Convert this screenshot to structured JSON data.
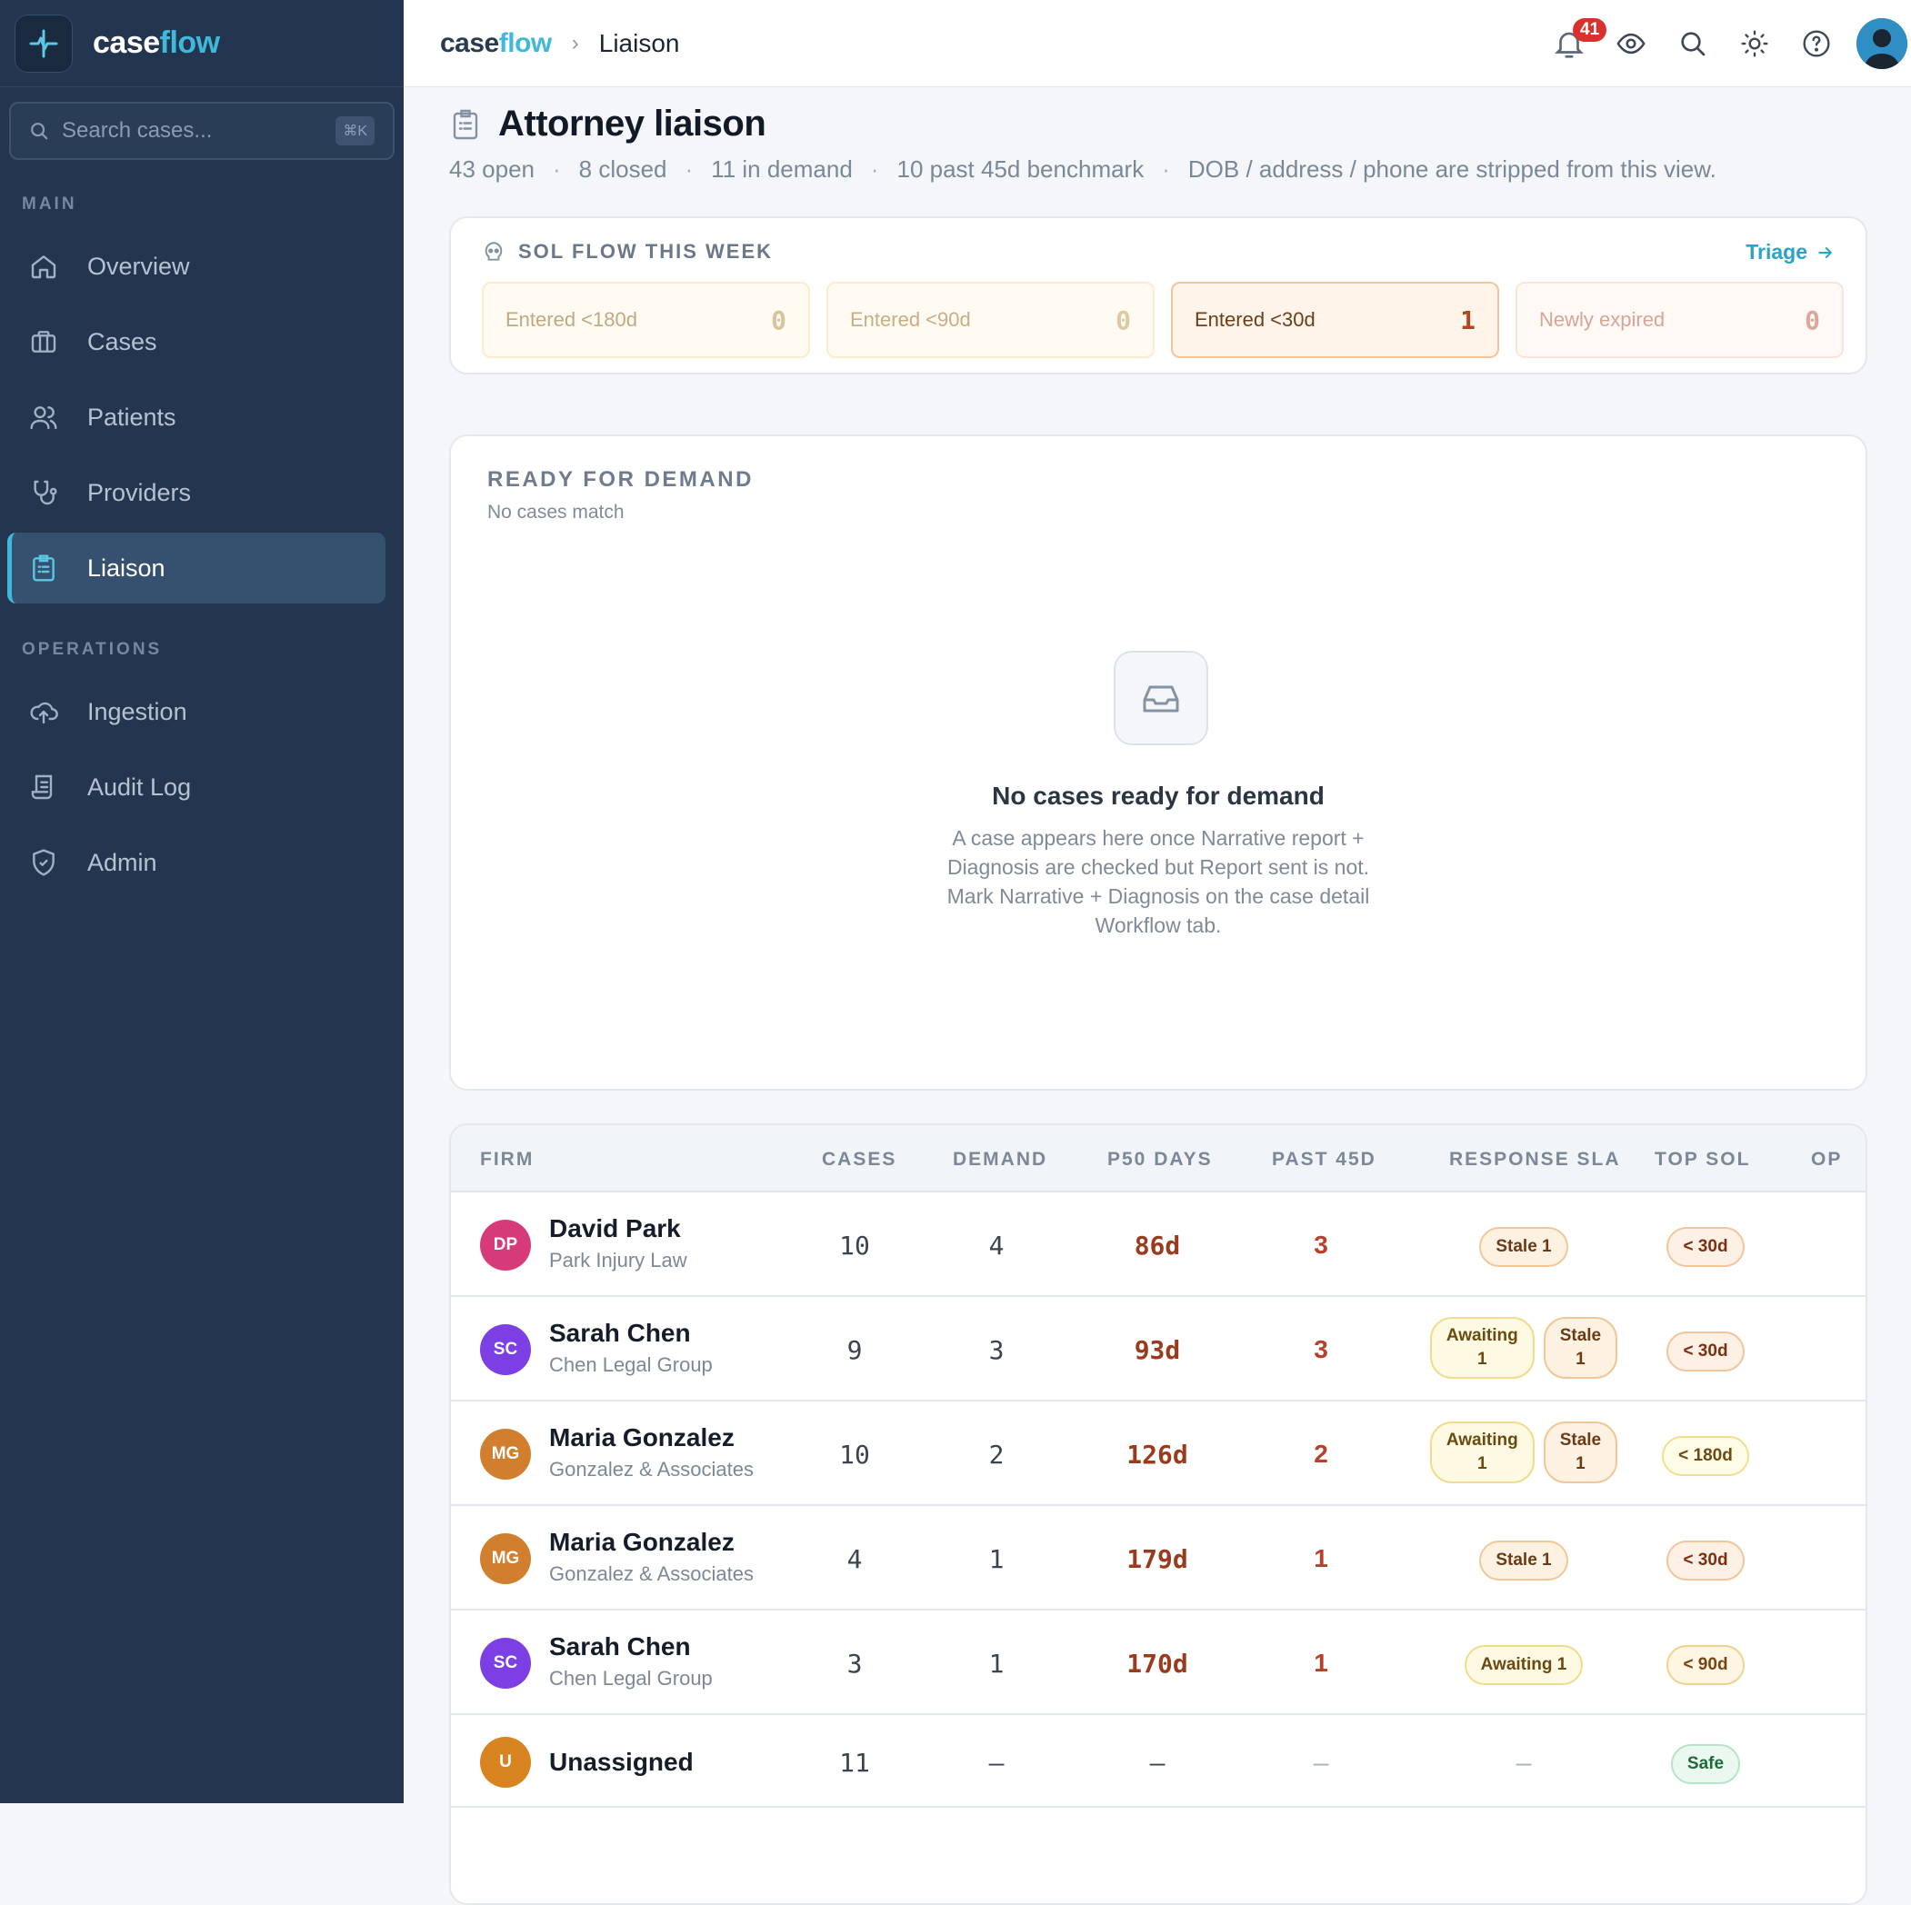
{
  "app": {
    "brand_case": "case",
    "brand_flow": "flow"
  },
  "sidebar": {
    "search_placeholder": "Search cases...",
    "search_shortcut": "⌘K",
    "main_label": "MAIN",
    "operations_label": "OPERATIONS",
    "main_items": [
      {
        "label": "Overview",
        "icon": "home-icon"
      },
      {
        "label": "Cases",
        "icon": "briefcase-icon"
      },
      {
        "label": "Patients",
        "icon": "users-icon"
      },
      {
        "label": "Providers",
        "icon": "stethoscope-icon"
      },
      {
        "label": "Liaison",
        "icon": "clipboard-list-icon",
        "active": true
      }
    ],
    "ops_items": [
      {
        "label": "Ingestion",
        "icon": "cloud-upload-icon"
      },
      {
        "label": "Audit Log",
        "icon": "scroll-icon"
      },
      {
        "label": "Admin",
        "icon": "shield-icon"
      }
    ]
  },
  "topbar": {
    "breadcrumb_page": "Liaison",
    "notification_count": "41"
  },
  "page": {
    "title": "Attorney liaison",
    "stats": [
      "43 open",
      "8 closed",
      "11 in demand",
      "10 past 45d benchmark",
      "DOB / address / phone are stripped from this view."
    ]
  },
  "sol_flow": {
    "title": "SOL FLOW THIS WEEK",
    "triage_label": "Triage",
    "tiles": [
      {
        "label": "Entered <180d",
        "value": "0"
      },
      {
        "label": "Entered <90d",
        "value": "0"
      },
      {
        "label": "Entered <30d",
        "value": "1"
      },
      {
        "label": "Newly expired",
        "value": "0"
      }
    ]
  },
  "ready": {
    "title": "READY FOR DEMAND",
    "subtitle": "No cases match",
    "empty_title": "No cases ready for demand",
    "empty_desc": "A case appears here once Narrative report + Diagnosis are checked but Report sent is not. Mark Narrative + Diagnosis on the case detail Workflow tab."
  },
  "table": {
    "headers": {
      "firm": "FIRM",
      "cases": "CASES",
      "demand": "DEMAND",
      "p50": "P50 DAYS",
      "past45": "PAST 45D",
      "sla": "RESPONSE SLA",
      "top_sol": "TOP SOL",
      "extra": "OP"
    },
    "rows": [
      {
        "initials": "DP",
        "color": "#d63a78",
        "name": "David Park",
        "firm": "Park Injury Law",
        "cases": "10",
        "demand": "4",
        "p50": "86d",
        "past45": "3",
        "sla": [
          {
            "kind": "stale",
            "text": "Stale 1"
          }
        ],
        "top_sol": {
          "kind": "sol30",
          "text": "< 30d"
        }
      },
      {
        "initials": "SC",
        "color": "#7b3fe4",
        "name": "Sarah Chen",
        "firm": "Chen Legal Group",
        "cases": "9",
        "demand": "3",
        "p50": "93d",
        "past45": "3",
        "sla": [
          {
            "kind": "await",
            "line1": "Awaiting",
            "line2": "1"
          },
          {
            "kind": "stale",
            "line1": "Stale",
            "line2": "1"
          }
        ],
        "top_sol": {
          "kind": "sol30",
          "text": "< 30d"
        }
      },
      {
        "initials": "MG",
        "color": "#d17f2e",
        "name": "Maria Gonzalez",
        "firm": "Gonzalez & Associates",
        "cases": "10",
        "demand": "2",
        "p50": "126d",
        "past45": "2",
        "sla": [
          {
            "kind": "await",
            "line1": "Awaiting",
            "line2": "1"
          },
          {
            "kind": "stale",
            "line1": "Stale",
            "line2": "1"
          }
        ],
        "top_sol": {
          "kind": "sol180",
          "text": "< 180d"
        }
      },
      {
        "initials": "MG",
        "color": "#d17f2e",
        "name": "Maria Gonzalez",
        "firm": "Gonzalez & Associates",
        "cases": "4",
        "demand": "1",
        "p50": "179d",
        "past45": "1",
        "sla": [
          {
            "kind": "stale",
            "text": "Stale 1"
          }
        ],
        "top_sol": {
          "kind": "sol30",
          "text": "< 30d"
        }
      },
      {
        "initials": "SC",
        "color": "#7b3fe4",
        "name": "Sarah Chen",
        "firm": "Chen Legal Group",
        "cases": "3",
        "demand": "1",
        "p50": "170d",
        "past45": "1",
        "sla": [
          {
            "kind": "await",
            "text": "Awaiting 1"
          }
        ],
        "top_sol": {
          "kind": "sol90",
          "text": "< 90d"
        }
      },
      {
        "initials": "U",
        "color": "#d7831f",
        "name": "Unassigned",
        "firm": "",
        "cases": "11",
        "demand": "–",
        "p50": "–",
        "past45": "–",
        "sla_dash": "—",
        "top_sol": {
          "kind": "safe",
          "text": "Safe"
        }
      }
    ]
  }
}
